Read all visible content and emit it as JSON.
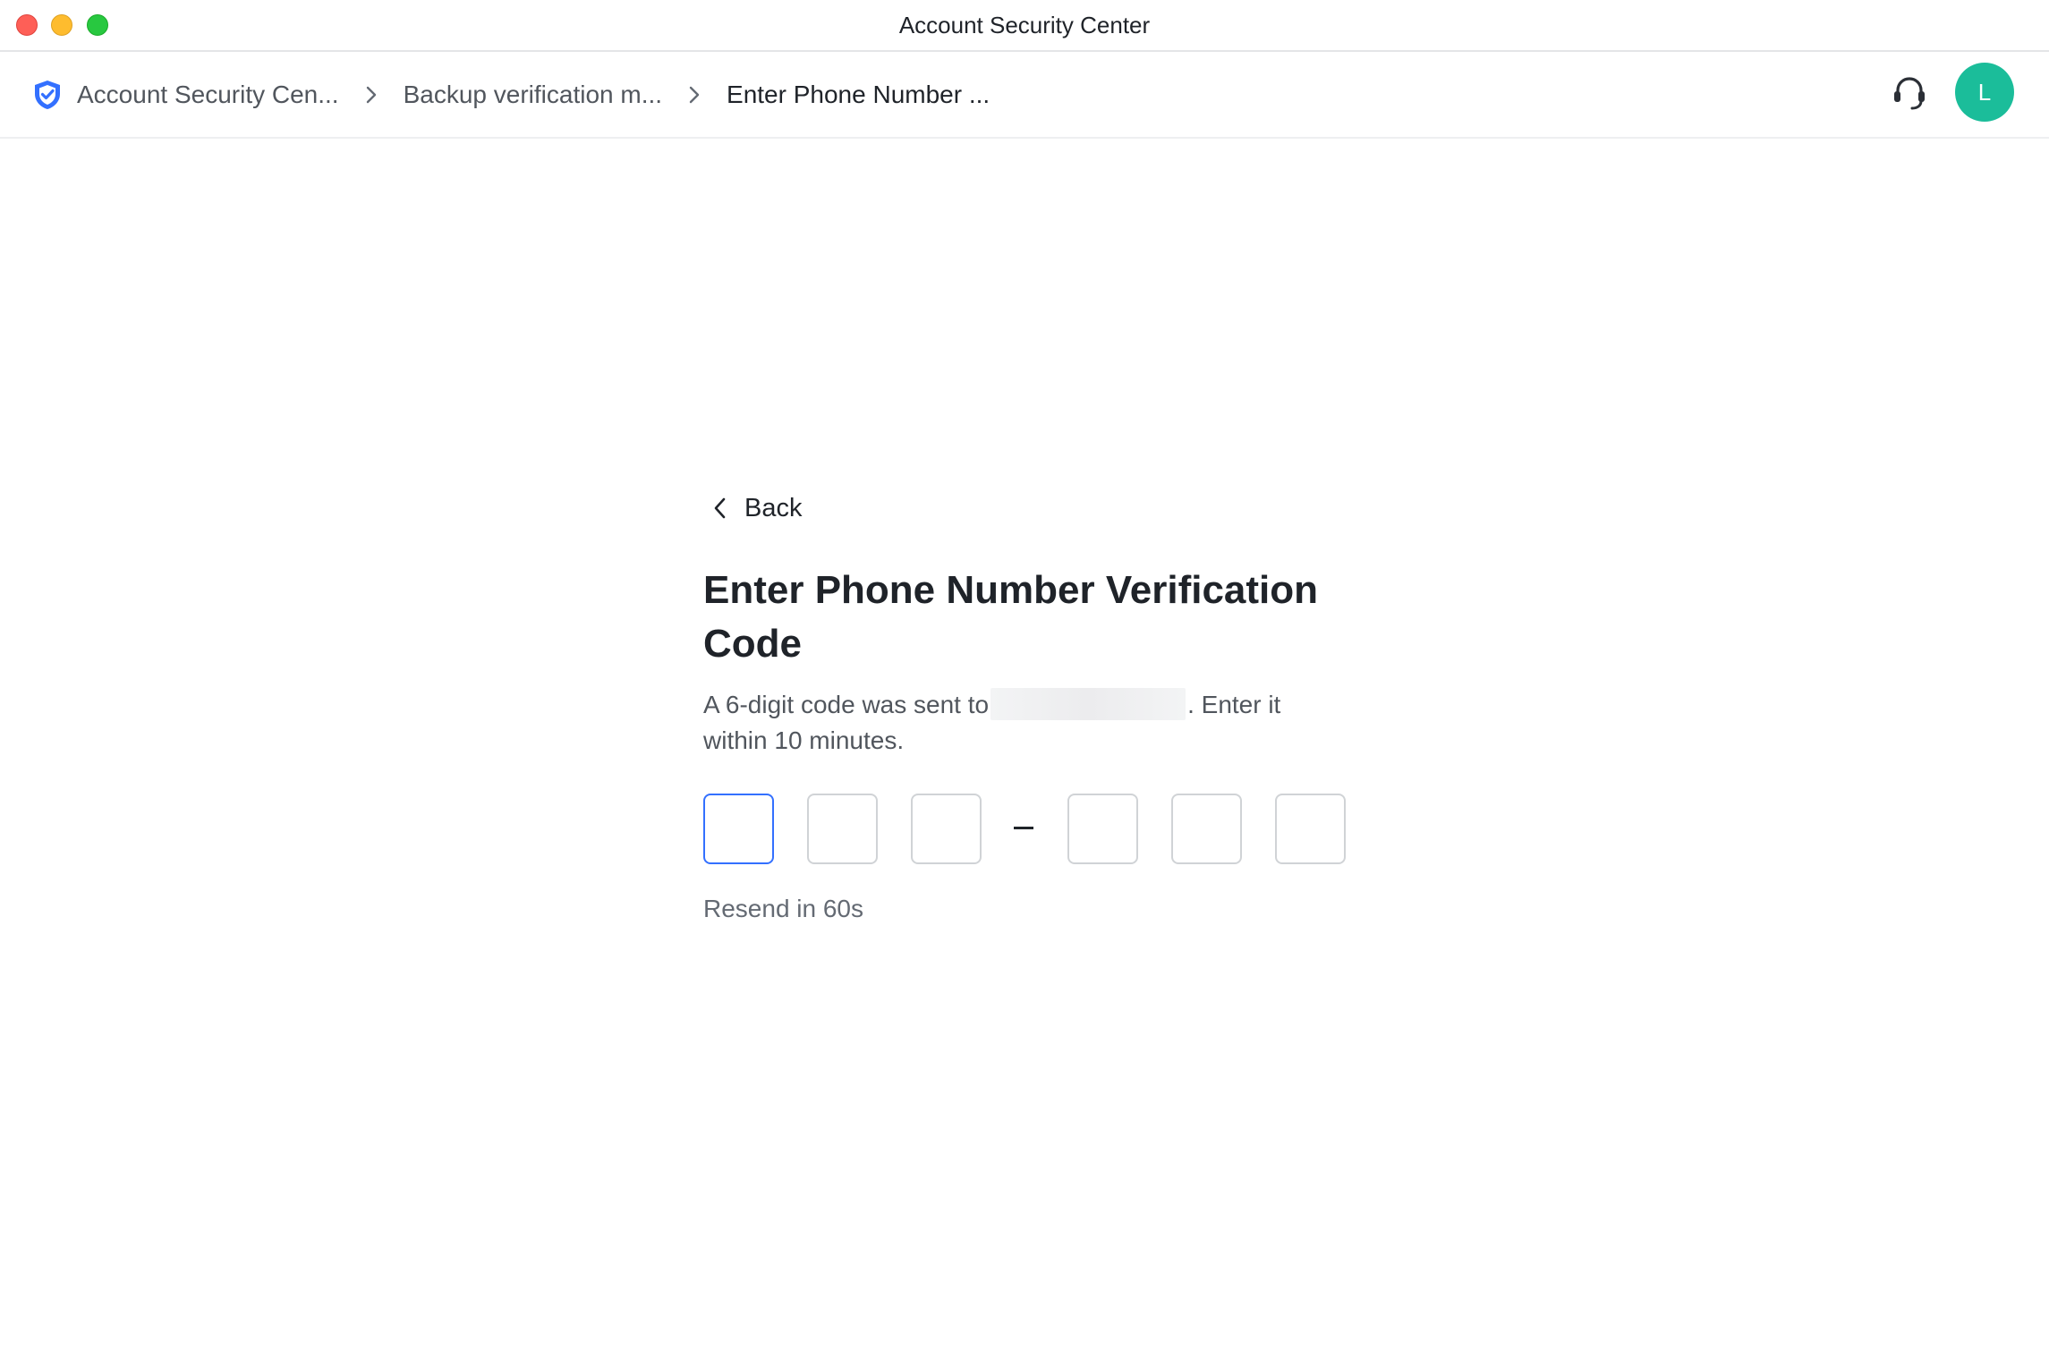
{
  "window": {
    "title": "Account Security Center"
  },
  "breadcrumb": {
    "items": [
      {
        "label": "Account Security Cen..."
      },
      {
        "label": "Backup verification m..."
      },
      {
        "label": "Enter Phone Number ..."
      }
    ]
  },
  "user": {
    "avatar_initial": "L",
    "avatar_color": "#1bbd9a"
  },
  "main": {
    "back_label": "Back",
    "title": "Enter Phone Number Verification Code",
    "description_prefix": "A 6-digit code was sent to",
    "description_suffix": ". Enter it within 10 minutes.",
    "code_digits": [
      "",
      "",
      "",
      "",
      "",
      ""
    ],
    "code_separator": "–",
    "resend_text": "Resend in 60s"
  },
  "colors": {
    "accent": "#3370ff",
    "shield": "#3370ff"
  },
  "icons": [
    "shield-icon",
    "chevron-right-icon",
    "headset-icon",
    "chevron-left-icon"
  ]
}
